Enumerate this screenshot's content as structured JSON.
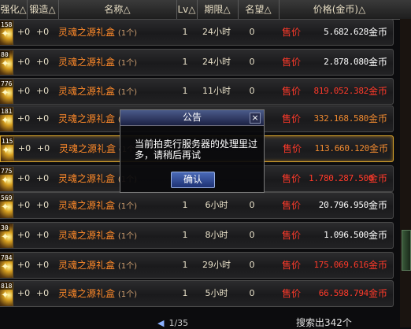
{
  "header": {
    "col_qianghua": "强化△",
    "col_duanzao": "锻造△",
    "col_name": "名称△",
    "col_lv": "Lv△",
    "col_qixian": "期限△",
    "col_mingwang": "名望△",
    "col_price": "价格(金币)△"
  },
  "rows": [
    {
      "badge": "158",
      "qianghua": "+0",
      "duanzao": "+0",
      "name": "灵魂之源礼盒",
      "qty": "(1个)",
      "lv": "1",
      "qixian": "24小时",
      "mingwang": "0",
      "price_label": "售价",
      "price": "5.682.628",
      "unit": "金币",
      "price_color": "white"
    },
    {
      "badge": "80",
      "qianghua": "+0",
      "duanzao": "+0",
      "name": "灵魂之源礼盒",
      "qty": "(1个)",
      "lv": "1",
      "qixian": "24小时",
      "mingwang": "0",
      "price_label": "售价",
      "price": "2.878.080",
      "unit": "金币",
      "price_color": "white"
    },
    {
      "badge": "7766",
      "qianghua": "+0",
      "duanzao": "+0",
      "name": "灵魂之源礼盒",
      "qty": "(1个)",
      "lv": "1",
      "qixian": "11小时",
      "mingwang": "0",
      "price_label": "售价",
      "price": "819.052.382",
      "unit": "金币",
      "price_color": "red"
    },
    {
      "badge": "181",
      "qianghua": "+0",
      "duanzao": "+0",
      "name": "灵魂之源礼盒",
      "qty": "(1个)",
      "lv": "1",
      "qixian": "",
      "mingwang": "",
      "price_label": "售价",
      "price": "332.168.580",
      "unit": "金币",
      "price_color": "orange"
    },
    {
      "badge": "115",
      "qianghua": "+0",
      "duanzao": "+0",
      "name": "灵魂之源礼盒",
      "qty": "(1个)",
      "lv": "",
      "qixian": "",
      "mingwang": "",
      "price_label": "售价",
      "price": "113.660.120",
      "unit": "金币",
      "price_color": "orange"
    },
    {
      "badge": "775",
      "qianghua": "+0",
      "duanzao": "+0",
      "name": "灵魂之源礼盒",
      "qty": "(1个)",
      "lv": "",
      "qixian": "",
      "mingwang": "",
      "price_label": "售价",
      "price": "1.780.287.500",
      "unit": "金币",
      "price_color": "red"
    },
    {
      "badge": "569",
      "qianghua": "+0",
      "duanzao": "+0",
      "name": "灵魂之源礼盒",
      "qty": "(1个)",
      "lv": "1",
      "qixian": "6小时",
      "mingwang": "0",
      "price_label": "售价",
      "price": "20.796.950",
      "unit": "金币",
      "price_color": "white"
    },
    {
      "badge": "30",
      "qianghua": "+0",
      "duanzao": "+0",
      "name": "灵魂之源礼盒",
      "qty": "(1个)",
      "lv": "1",
      "qixian": "8小时",
      "mingwang": "0",
      "price_label": "售价",
      "price": "1.096.500",
      "unit": "金币",
      "price_color": "white"
    },
    {
      "badge": "784",
      "qianghua": "+0",
      "duanzao": "+0",
      "name": "灵魂之源礼盒",
      "qty": "(1个)",
      "lv": "1",
      "qixian": "29小时",
      "mingwang": "0",
      "price_label": "售价",
      "price": "175.069.616",
      "unit": "金币",
      "price_color": "red"
    },
    {
      "badge": "818",
      "qianghua": "+0",
      "duanzao": "+0",
      "name": "灵魂之源礼盒",
      "qty": "(1个)",
      "lv": "1",
      "qixian": "5小时",
      "mingwang": "0",
      "price_label": "售价",
      "price": "66.598.794",
      "unit": "金币",
      "price_color": "red"
    }
  ],
  "dialog": {
    "title": "公告",
    "close": "×",
    "message": "当前拍卖行服务器的处理里过多，请稍后再试",
    "ok_label": "确认"
  },
  "pager": {
    "arrow": "◀",
    "text": "1/35"
  },
  "search_count": "搜索出342个",
  "colors": {
    "name": "#ff8a2a",
    "price_red": "#ff3a2a",
    "price_orange": "#f08a30",
    "selected_border": "#d9a62e"
  },
  "icons": {
    "row_item": "star-gem-icon",
    "close": "close-icon",
    "pager_prev": "arrow-left-icon"
  }
}
